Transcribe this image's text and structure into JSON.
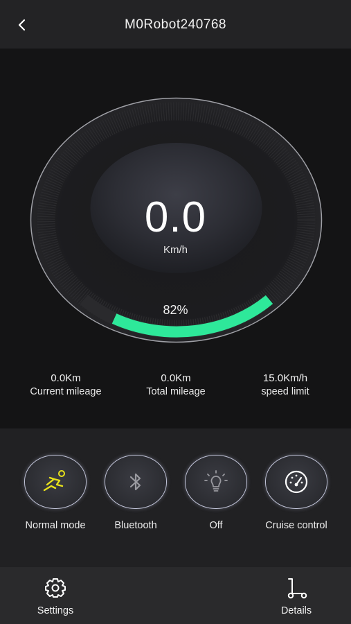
{
  "header": {
    "title": "M0Robot240768",
    "back_icon": "chevron-left-icon"
  },
  "speedometer": {
    "speed": "0.0",
    "unit": "Km/h",
    "battery_percent_label": "82%",
    "battery_level": 0.82,
    "accent_color": "#2ee89a"
  },
  "stats": [
    {
      "value": "0.0Km",
      "label": "Current mileage"
    },
    {
      "value": "0.0Km",
      "label": "Total mileage"
    },
    {
      "value": "15.0Km/h",
      "label": "speed limit"
    }
  ],
  "controls": [
    {
      "label": "Normal mode",
      "icon": "running-person-icon",
      "icon_color": "#e8e21a"
    },
    {
      "label": "Bluetooth",
      "icon": "bluetooth-icon",
      "icon_color": "#9a9aa0"
    },
    {
      "label": "Off",
      "icon": "light-bulb-icon",
      "icon_color": "#9a9aa0"
    },
    {
      "label": "Cruise control",
      "icon": "speedometer-icon",
      "icon_color": "#ffffff"
    }
  ],
  "bottom_nav": {
    "settings_label": "Settings",
    "details_label": "Details"
  }
}
